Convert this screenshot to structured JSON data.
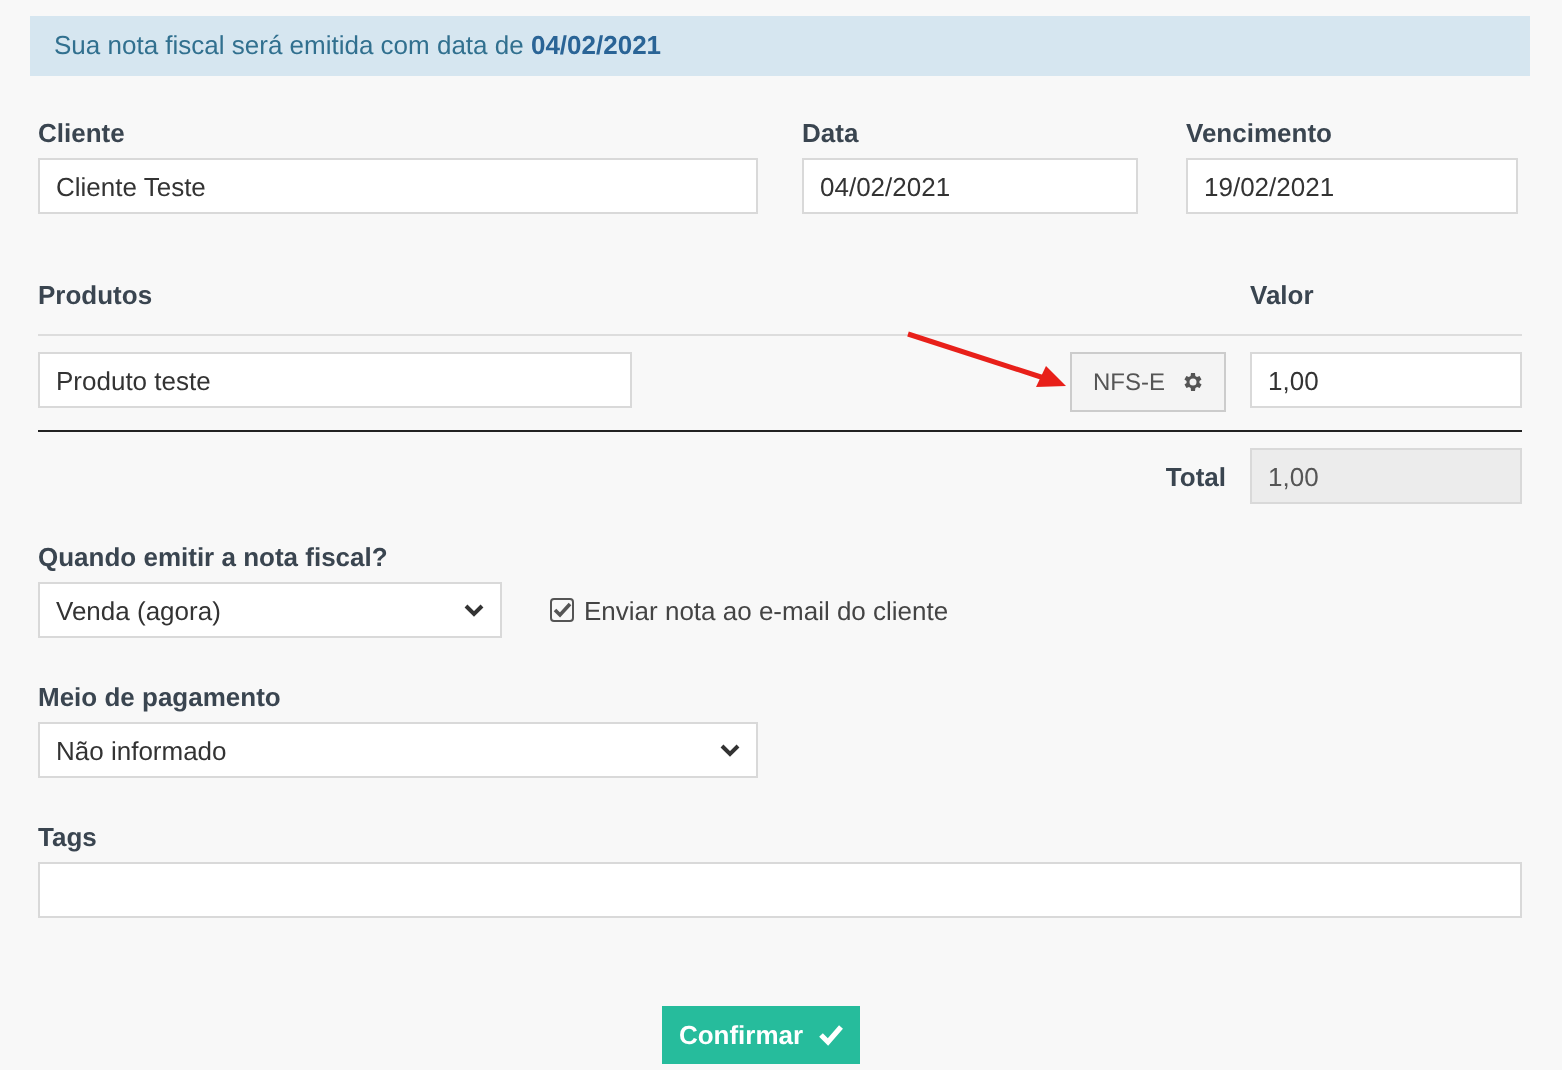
{
  "notice": "Sua nota fiscal será emitida com data de **04/02/2021**",
  "fields": [
    {
      "label": "Cliente",
      "value": "Cliente Teste"
    },
    {
      "label": "Data",
      "value": "04/02/2021"
    },
    {
      "label": "Vencimento",
      "value": "19/02/2021"
    }
  ],
  "products": {
    "label": "Produtos",
    "value_label": "Valor",
    "rows": [
      {
        "name": "Produto teste",
        "type_button": "NFS-E",
        "value": "1,00"
      }
    ],
    "total_label": "Total",
    "total": "1,00"
  },
  "emit": {
    "label": "Quando emitir a nota fiscal?",
    "value": "Venda (agora)",
    "send_email": {
      "label": "Enviar nota ao e-mail do cliente",
      "checked": true
    }
  },
  "payment": {
    "label": "Meio de pagamento",
    "value": "Não informado"
  },
  "tags": {
    "label": "Tags"
  },
  "confirm_button": "Confirmar"
}
